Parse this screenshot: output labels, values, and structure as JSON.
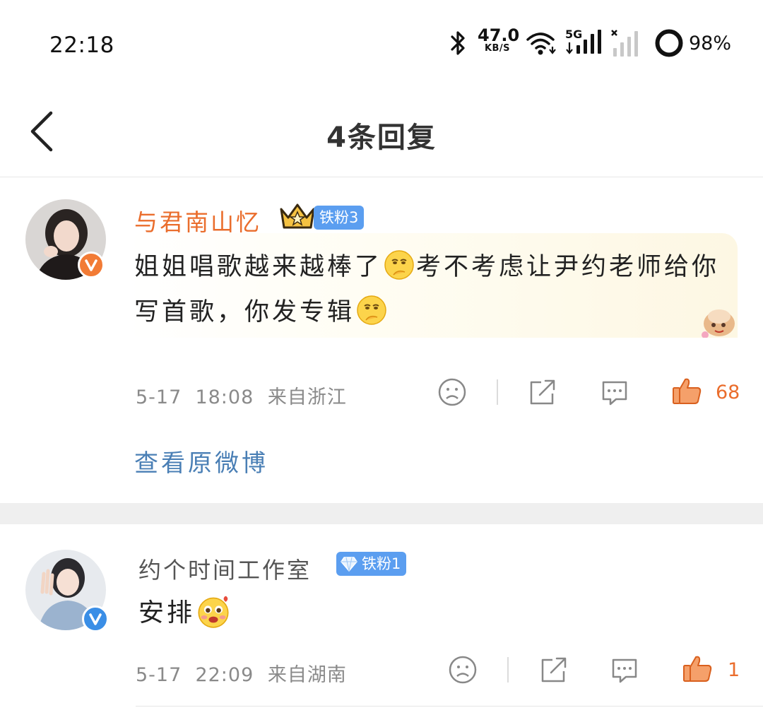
{
  "status_bar": {
    "time": "22:18",
    "net_speed_value": "47.0",
    "net_speed_unit": "KB/S",
    "signal_label": "5G",
    "battery": "98%"
  },
  "header": {
    "title": "4条回复",
    "back_icon": "chevron-left-icon"
  },
  "comments": [
    {
      "username": "与君南山忆",
      "fan_badge": "铁粉3",
      "verified": true,
      "verified_color": "#f27b35",
      "body_parts": [
        "姐姐唱歌越来越棒了",
        "考不考虑让尹约老师给你写首歌，你发专辑"
      ],
      "emoji": "thinking-face-icon",
      "time": "5-17  18:08",
      "location": "来自浙江",
      "likes": "68",
      "view_post": "查看原微博"
    },
    {
      "username": "约个时间工作室",
      "fan_badge": "铁粉1",
      "verified": true,
      "verified_color": "#3a8ee6",
      "body": "安排",
      "emoji": "love-face-icon",
      "time": "5-17  22:09",
      "location": "来自湖南",
      "likes": "1"
    }
  ],
  "colors": {
    "accent_orange": "#ea6d2c",
    "link_blue": "#4a7fb5",
    "badge_blue": "#5b9ef0"
  }
}
